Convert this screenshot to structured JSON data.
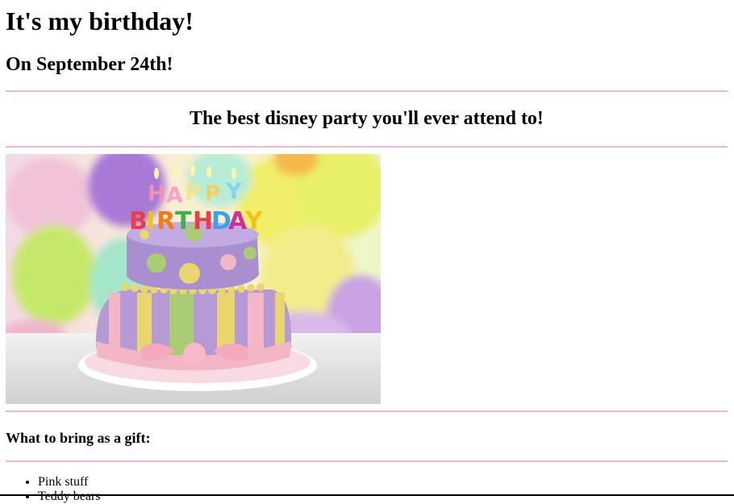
{
  "heading": "It's my birthday!",
  "date_heading": "On September 24th!",
  "tagline": "The best disney party you'll ever attend to!",
  "image": {
    "alt": "Birthday cake with colorful balloons",
    "candle_letters": [
      "H",
      "A",
      "P",
      "P",
      "Y",
      "B",
      "I",
      "R",
      "T",
      "H",
      "D",
      "A",
      "Y"
    ],
    "colors": {
      "rule": "#f4b8c8",
      "cake_purple": "#b59ad6",
      "cake_pink": "#f3b6c6",
      "cake_yellow": "#ead66e",
      "cake_green": "#a9cc74"
    }
  },
  "gifts": {
    "heading": "What to bring as a gift:",
    "items": [
      "Pink stuff",
      "Teddy bears"
    ]
  }
}
